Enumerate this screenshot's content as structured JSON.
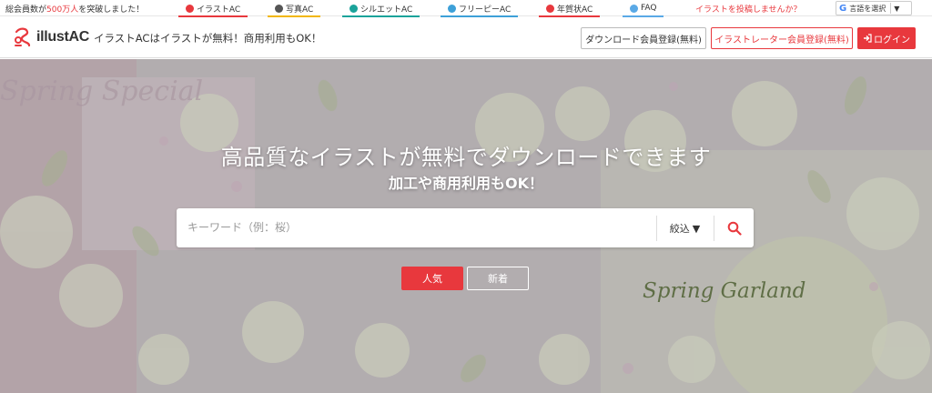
{
  "topbar": {
    "members_prefix": "総会員数が",
    "members_count": "500万人",
    "members_suffix": "を突破しました！",
    "sites": [
      {
        "label": "イラストAC",
        "icon": "illustac-icon",
        "color": "#e8383d"
      },
      {
        "label": "写真AC",
        "icon": "photoac-icon",
        "color": "#f2b705"
      },
      {
        "label": "シルエットAC",
        "icon": "silhouetteac-icon",
        "color": "#1aa39a"
      },
      {
        "label": "フリーピーAC",
        "icon": "freepik-icon",
        "color": "#3da0d8"
      },
      {
        "label": "年賀状AC",
        "icon": "nengajo-icon",
        "color": "#e8383d"
      },
      {
        "label": "FAQ",
        "icon": "faq-icon",
        "color": "#5aa9e6"
      }
    ],
    "post_link": "イラストを投稿しませんか？",
    "lang_label": "言語を選択",
    "lang_arrow": "▼"
  },
  "header": {
    "logo_text": "illustAC",
    "tagline": "イラストACはイラストが無料！商用利用もOK！",
    "download_register": "ダウンロード会員登録(無料)",
    "illustrator_register": "イラストレーター会員登録(無料)",
    "login": "ログイン"
  },
  "hero": {
    "title": "高品質なイラストが無料でダウンロードできます",
    "subtitle": "加工や商用利用もOK！",
    "search_placeholder": "キーワード（例：桜）",
    "filter_label": "絞込",
    "filter_arrow": "▼",
    "tab_popular": "人気",
    "tab_new": "新着",
    "bg_text_right": "Spring Garland",
    "bg_text_left": "Spring Special"
  },
  "colors": {
    "accent": "#e8383d",
    "hero_overlay": "#b9b6b8"
  }
}
